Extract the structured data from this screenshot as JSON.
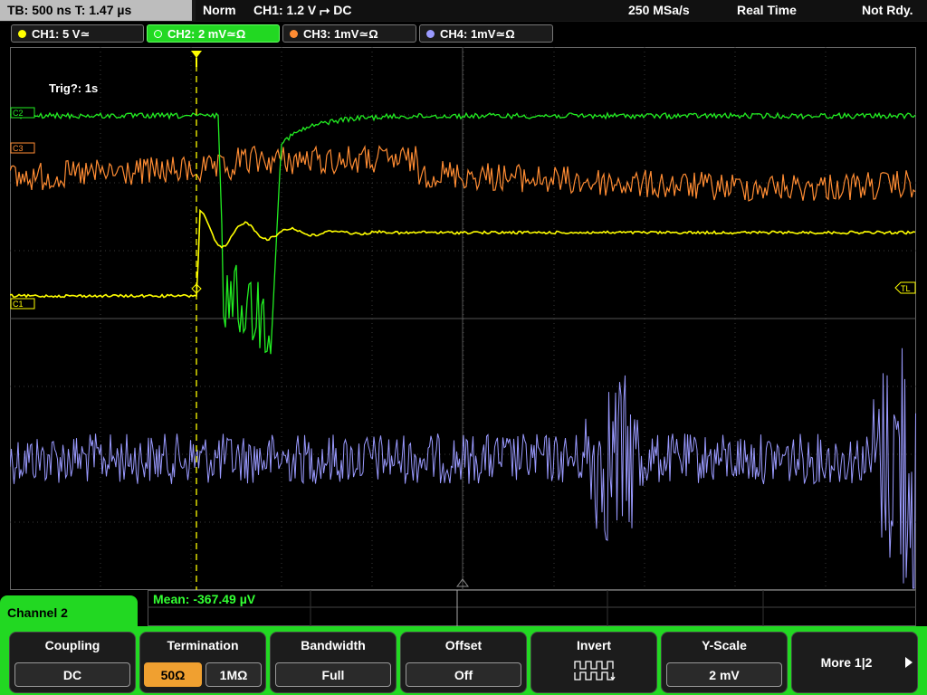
{
  "status": {
    "timebase": "TB: 500 ns   T: 1.47 µs",
    "trigger_mode": "Norm",
    "trigger_info": "CH1: 1.2 V ⮣ DC",
    "sample_rate": "250 MSa/s",
    "acq_mode": "Real Time",
    "state": "Not Rdy."
  },
  "channels": [
    {
      "label": "CH1: 5 V≃",
      "color": "#ffff00"
    },
    {
      "label": "CH2: 2 mV≃Ω",
      "color": "#22ee22"
    },
    {
      "label": "CH3: 1mV≃Ω",
      "color": "#ff8c33"
    },
    {
      "label": "CH4: 1mV≃Ω",
      "color": "#9a9aff"
    }
  ],
  "scope": {
    "trig_annotation": "Trig?: 1s",
    "markers": {
      "c1": "C1",
      "c2": "C2",
      "c3": "C3",
      "tl": "TL"
    }
  },
  "measurement": {
    "mean": "Mean: -367.49 µV"
  },
  "menu": {
    "title": "Channel 2",
    "coupling": {
      "title": "Coupling",
      "value": "DC"
    },
    "termination": {
      "title": "Termination",
      "opt1": "50Ω",
      "opt2": "1MΩ"
    },
    "bandwidth": {
      "title": "Bandwidth",
      "value": "Full"
    },
    "offset": {
      "title": "Offset",
      "value": "Off"
    },
    "invert": {
      "title": "Invert"
    },
    "yscale": {
      "title": "Y-Scale",
      "value": "2 mV"
    },
    "more": {
      "label": "More 1|2"
    }
  },
  "colors": {
    "ch1": "#ffff00",
    "ch2": "#22ee22",
    "ch3": "#ff8c33",
    "ch4": "#9a9aff",
    "menu_accent": "#22d822",
    "selected": "#f0a030"
  }
}
